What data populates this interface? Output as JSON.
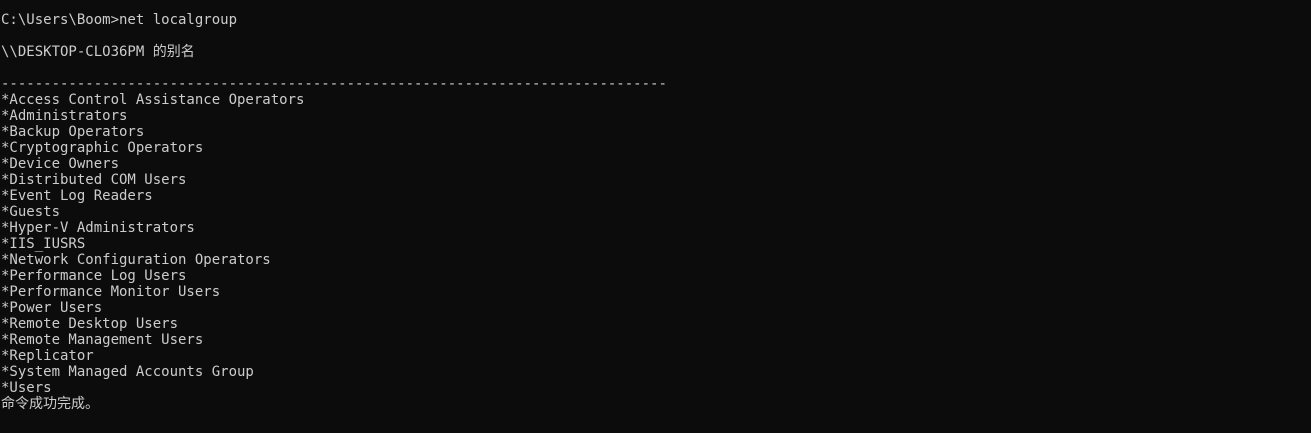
{
  "console": {
    "prompt": "C:\\Users\\Boom>net localgroup",
    "alias_header": "\\\\DESKTOP-CLO36PM 的别名",
    "separator": "-------------------------------------------------------------------------------",
    "groups": [
      "*Access Control Assistance Operators",
      "*Administrators",
      "*Backup Operators",
      "*Cryptographic Operators",
      "*Device Owners",
      "*Distributed COM Users",
      "*Event Log Readers",
      "*Guests",
      "*Hyper-V Administrators",
      "*IIS_IUSRS",
      "*Network Configuration Operators",
      "*Performance Log Users",
      "*Performance Monitor Users",
      "*Power Users",
      "*Remote Desktop Users",
      "*Remote Management Users",
      "*Replicator",
      "*System Managed Accounts Group",
      "*Users"
    ],
    "completion_message": "命令成功完成。"
  },
  "colors": {
    "background": "#0c0c0c",
    "text": "#cccccc"
  }
}
